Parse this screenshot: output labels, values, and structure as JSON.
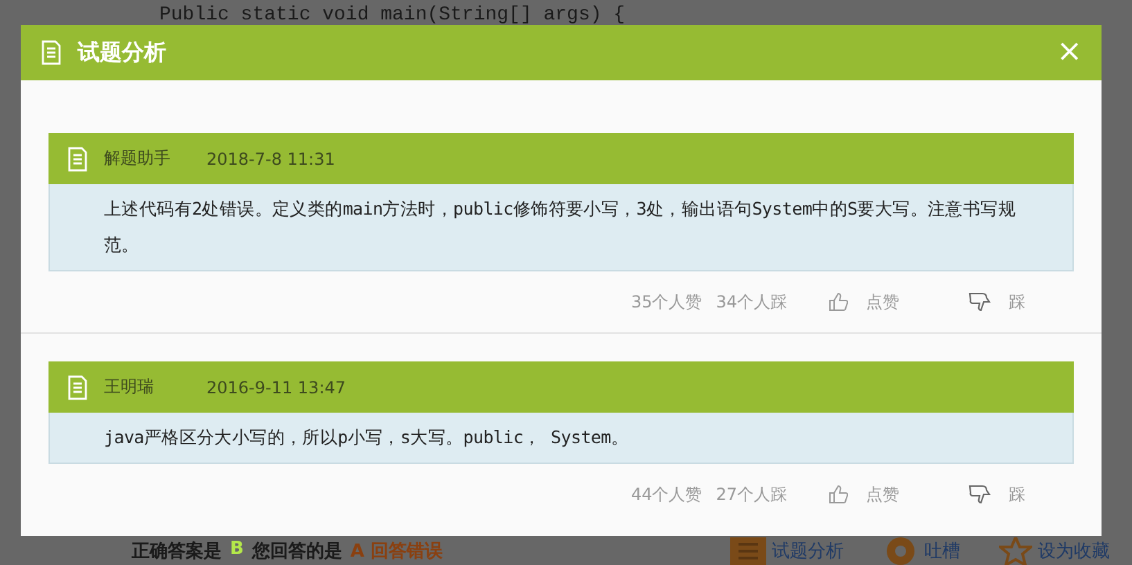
{
  "background_page": {
    "code_line": "Public static void main(String[] args) {",
    "answer_bar": [
      {
        "kind": "plain",
        "text": "正确答案是"
      },
      {
        "kind": "correct",
        "text": "B"
      },
      {
        "kind": "plain",
        "text": "您回答的是"
      },
      {
        "kind": "wrong",
        "text": "A 回答错误"
      }
    ],
    "actions": [
      {
        "kind": "analysis",
        "label": "试题分析"
      },
      {
        "kind": "comment",
        "label": "吐槽"
      },
      {
        "kind": "favorite",
        "label": "设为收藏"
      }
    ]
  },
  "dialog": {
    "title": "试题分析",
    "close": "×",
    "comments": [
      {
        "author": "解题助手",
        "date": "2018-7-8 11:31",
        "text": "上述代码有2处错误。定义类的main方法时，public修饰符要小写，3处，输出语句System中的S要大写。注意书写规范。",
        "likes": "35个人赞",
        "dislikes": "34个人踩",
        "like_button": "点赞",
        "dislike_button": "踩"
      },
      {
        "author": "王明瑞",
        "date": "2016-9-11 13:47",
        "text": "java严格区分大小写的，所以p小写，s大写。public， System。",
        "likes": "44个人赞",
        "dislikes": "27个人踩",
        "like_button": "点赞",
        "dislike_button": "踩"
      }
    ]
  }
}
